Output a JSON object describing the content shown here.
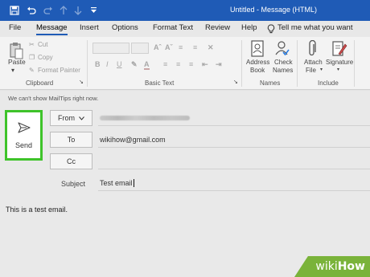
{
  "titlebar": {
    "title": "Untitled  -  Message (HTML)",
    "save_icon": "save-icon",
    "undo_icon": "undo-icon",
    "redo_icon": "redo-icon",
    "up_icon": "arrow-up-icon",
    "down_icon": "arrow-down-icon",
    "customize_icon": "customize-icon"
  },
  "tabs": [
    "File",
    "Message",
    "Insert",
    "Options",
    "Format Text",
    "Review",
    "Help"
  ],
  "tell_me": "Tell me what you want",
  "ribbon": {
    "clipboard": {
      "paste": "Paste",
      "cut": "Cut",
      "copy": "Copy",
      "format_painter": "Format Painter",
      "label": "Clipboard"
    },
    "basic_text": {
      "label": "Basic Text",
      "bold": "B",
      "italic": "I",
      "underline": "U",
      "font_color": "A"
    },
    "names": {
      "address_book": "Address",
      "address_book_2": "Book",
      "check_names": "Check",
      "check_names_2": "Names",
      "label": "Names"
    },
    "include": {
      "attach_file": "Attach",
      "attach_file_2": "File",
      "signature": "Signature",
      "label": "Include"
    }
  },
  "mailtips": "We can't show MailTips right now.",
  "compose": {
    "send_label": "Send",
    "from_label": "From",
    "to_label": "To",
    "cc_label": "Cc",
    "subject_label": "Subject",
    "to_value": "wikihow@gmail.com",
    "subject_value": "Test email",
    "body": "This is a test email."
  },
  "watermark": {
    "wiki": "wiki",
    "how": "How"
  },
  "colors": {
    "titlebar": "#1f5bb6",
    "send_highlight": "#3ec32a",
    "watermark": "#7ab33a"
  }
}
